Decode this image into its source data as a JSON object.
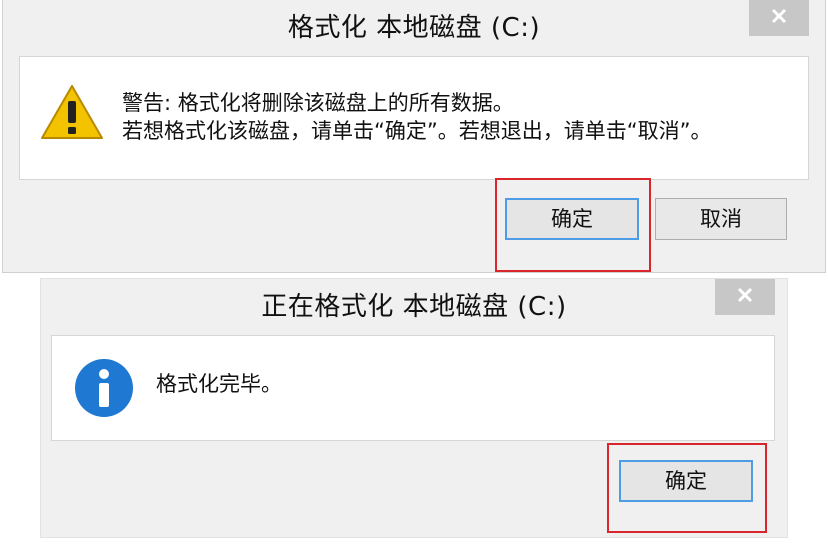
{
  "format_dialog": {
    "title": "格式化 本地磁盘 (C:)",
    "icon": "warning-icon",
    "message_line1": "警告: 格式化将删除该磁盘上的所有数据。",
    "message_line2": "若想格式化该磁盘，请单击“确定”。若想退出，请单击“取消”。",
    "ok_label": "确定",
    "cancel_label": "取消",
    "close_icon": "close-icon"
  },
  "progress_dialog": {
    "title": "正在格式化 本地磁盘 (C:)",
    "icon": "info-icon",
    "message": "格式化完毕。",
    "ok_label": "确定",
    "close_icon": "close-icon"
  },
  "colors": {
    "highlight": "#d8262c",
    "default_button_border": "#4e9be6",
    "warning_yellow": "#f3c300",
    "info_blue": "#1f78d1"
  }
}
